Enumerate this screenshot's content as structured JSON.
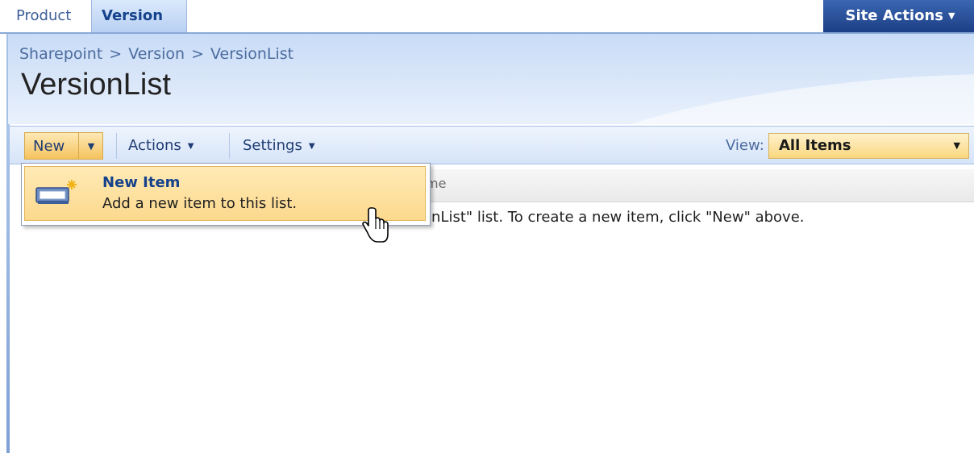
{
  "top_nav": {
    "tabs": [
      {
        "label": "Product",
        "selected": false
      },
      {
        "label": "Version",
        "selected": true
      }
    ],
    "site_actions_label": "Site Actions"
  },
  "title_area": {
    "breadcrumb": [
      "Sharepoint",
      "Version",
      "VersionList"
    ],
    "breadcrumb_separator": ">",
    "page_title": "VersionList"
  },
  "toolbar": {
    "new_label": "New",
    "actions_label": "Actions",
    "settings_label": "Settings",
    "view_label": "View:",
    "view_selected": "All Items"
  },
  "new_menu": {
    "item_title": "New Item",
    "item_description": "Add a new item to this list.",
    "icon": "new-item-icon"
  },
  "list": {
    "visible_column_header_fragment": "me",
    "visible_empty_message_fragment": "onList\" list. To create a new item, click \"New\" above."
  },
  "colors": {
    "accent_blue": "#1c3f85",
    "highlight_gold": "#f6c35e",
    "title_bg": "#c9dcf7"
  }
}
